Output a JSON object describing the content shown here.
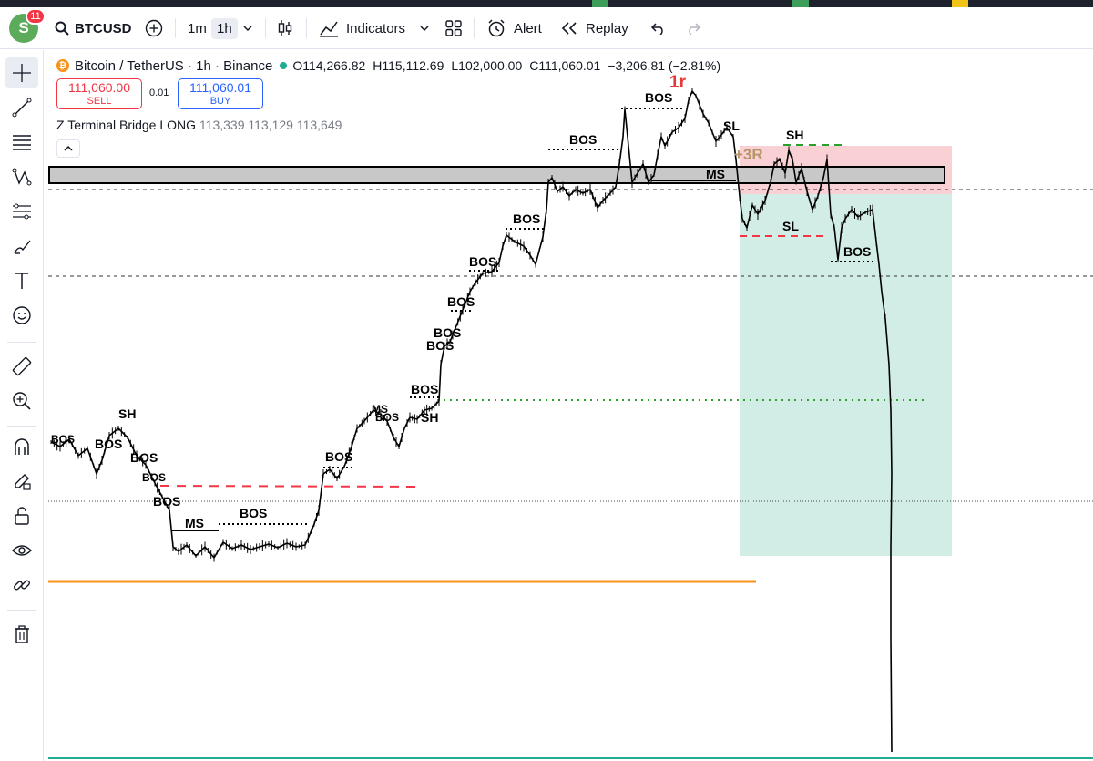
{
  "window": {
    "accent_green": "#089981",
    "accent_red": "#f23645",
    "accent_blue": "#2962ff"
  },
  "toolbar": {
    "avatar_letter": "S",
    "avatar_badge": "11",
    "symbol": "BTCUSD",
    "intervals": [
      "1m",
      "1h"
    ],
    "active_interval": "1h",
    "indicators_label": "Indicators",
    "alert_label": "Alert",
    "replay_label": "Replay"
  },
  "sidebar": {
    "tools": [
      "crosshair-icon",
      "trend-line-icon",
      "fib-icon",
      "pattern-icon",
      "projection-icon",
      "brush-icon",
      "text-icon",
      "emoji-icon",
      "ruler-icon",
      "zoom-in-icon",
      "magnet-icon",
      "lock-drawing-icon",
      "lock-icon",
      "eye-icon",
      "link-icon",
      "trash-icon"
    ]
  },
  "legend": {
    "title": "Bitcoin / TetherUS · 1h · Binance",
    "open": "O114,266.82",
    "high": "H115,112.69",
    "low": "L102,000.00",
    "close": "C111,060.01",
    "change": "−3,206.81 (−2.81%)"
  },
  "trade": {
    "sell_price": "111,060.00",
    "sell_label": "SELL",
    "quantity": "0.01",
    "buy_price": "111,060.01",
    "buy_label": "BUY"
  },
  "indicator": {
    "name": "Z Terminal Bridge LONG",
    "values": "113,339 113,129 113,649"
  },
  "chart_labels": {
    "one_r": "1r",
    "three_r": "+3R",
    "bos": "BOS",
    "ms": "MS",
    "sh": "SH",
    "sl": "SL"
  }
}
